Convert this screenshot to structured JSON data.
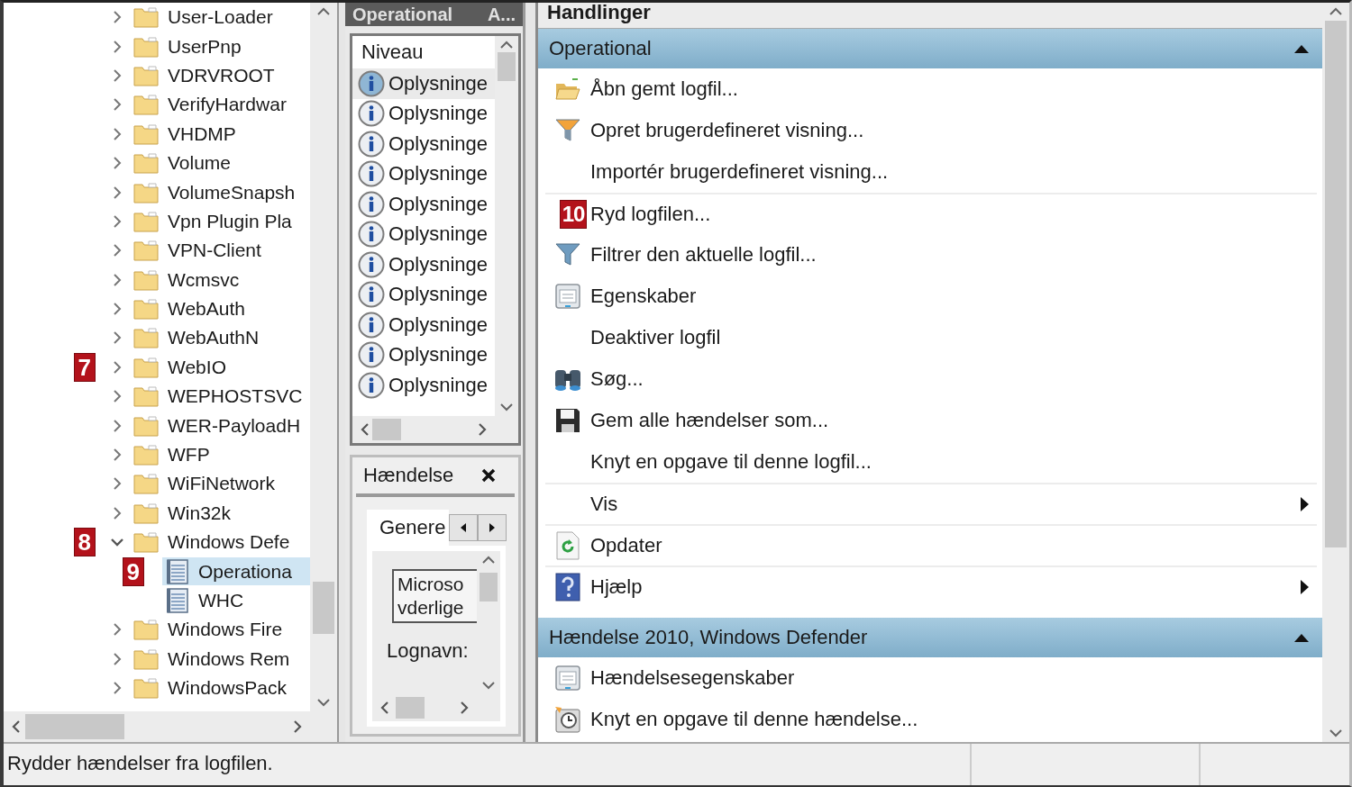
{
  "tree": {
    "items": [
      {
        "label": "User-Loader",
        "kind": "folder",
        "expanded": false,
        "selected": false
      },
      {
        "label": "UserPnp",
        "kind": "folder",
        "expanded": false,
        "selected": false
      },
      {
        "label": "VDRVROOT",
        "kind": "folder",
        "expanded": false,
        "selected": false
      },
      {
        "label": "VerifyHardwar",
        "kind": "folder",
        "expanded": false,
        "selected": false
      },
      {
        "label": "VHDMP",
        "kind": "folder",
        "expanded": false,
        "selected": false
      },
      {
        "label": "Volume",
        "kind": "folder",
        "expanded": false,
        "selected": false
      },
      {
        "label": "VolumeSnapsh",
        "kind": "folder",
        "expanded": false,
        "selected": false
      },
      {
        "label": "Vpn Plugin Pla",
        "kind": "folder",
        "expanded": false,
        "selected": false
      },
      {
        "label": "VPN-Client",
        "kind": "folder",
        "expanded": false,
        "selected": false
      },
      {
        "label": "Wcmsvc",
        "kind": "folder",
        "expanded": false,
        "selected": false
      },
      {
        "label": "WebAuth",
        "kind": "folder",
        "expanded": false,
        "selected": false
      },
      {
        "label": "WebAuthN",
        "kind": "folder",
        "expanded": false,
        "selected": false
      },
      {
        "label": "WebIO",
        "kind": "folder",
        "expanded": false,
        "selected": false,
        "badge": "7"
      },
      {
        "label": "WEPHOSTSVC",
        "kind": "folder",
        "expanded": false,
        "selected": false
      },
      {
        "label": "WER-PayloadH",
        "kind": "folder",
        "expanded": false,
        "selected": false
      },
      {
        "label": "WFP",
        "kind": "folder",
        "expanded": false,
        "selected": false
      },
      {
        "label": "WiFiNetwork",
        "kind": "folder",
        "expanded": false,
        "selected": false
      },
      {
        "label": "Win32k",
        "kind": "folder",
        "expanded": false,
        "selected": false
      },
      {
        "label": "Windows Defe",
        "kind": "folder",
        "expanded": true,
        "selected": false,
        "badge": "8",
        "children": [
          {
            "label": "Operationa",
            "kind": "log",
            "selected": true,
            "badge": "9"
          },
          {
            "label": "WHC",
            "kind": "log",
            "selected": false
          }
        ]
      },
      {
        "label": "Windows Fire",
        "kind": "folder",
        "expanded": false,
        "selected": false
      },
      {
        "label": "Windows Rem",
        "kind": "folder",
        "expanded": false,
        "selected": false
      },
      {
        "label": "WindowsPack",
        "kind": "folder",
        "expanded": false,
        "selected": false
      }
    ]
  },
  "events": {
    "title": "Operational",
    "title_2": "A...",
    "column": "Niveau",
    "rows": [
      {
        "level": "Oplysninge",
        "selected": true
      },
      {
        "level": "Oplysninge",
        "selected": false
      },
      {
        "level": "Oplysninge",
        "selected": false
      },
      {
        "level": "Oplysninge",
        "selected": false
      },
      {
        "level": "Oplysninge",
        "selected": false
      },
      {
        "level": "Oplysninge",
        "selected": false
      },
      {
        "level": "Oplysninge",
        "selected": false
      },
      {
        "level": "Oplysninge",
        "selected": false
      },
      {
        "level": "Oplysninge",
        "selected": false
      },
      {
        "level": "Oplysninge",
        "selected": false
      },
      {
        "level": "Oplysninge",
        "selected": false
      }
    ]
  },
  "event_panel": {
    "title": "Hændelse",
    "tabs": [
      {
        "label": "Genere",
        "selected": true
      }
    ],
    "field_lines": [
      "Microso",
      "vderlige"
    ],
    "label": "Lognavn:"
  },
  "actions": {
    "title": "Handlinger",
    "sections": [
      {
        "title": "Operational",
        "expanded": true,
        "items": [
          {
            "label": "Åbn gemt logfil...",
            "kind": "open",
            "separator_above": false,
            "submenu": false
          },
          {
            "label": "Opret brugerdefineret visning...",
            "kind": "custom-view",
            "separator_above": false,
            "submenu": false
          },
          {
            "label": "Importér brugerdefineret visning...",
            "kind": "plain",
            "separator_above": false,
            "submenu": false
          },
          {
            "label": "Ryd logfilen...",
            "kind": "plain",
            "separator_above": true,
            "submenu": false,
            "badge": "10"
          },
          {
            "label": "Filtrer den aktuelle logfil...",
            "kind": "filter",
            "separator_above": false,
            "submenu": false
          },
          {
            "label": "Egenskaber",
            "kind": "properties",
            "separator_above": false,
            "submenu": false
          },
          {
            "label": "Deaktiver logfil",
            "kind": "plain",
            "separator_above": false,
            "submenu": false
          },
          {
            "label": "Søg...",
            "kind": "find",
            "separator_above": false,
            "submenu": false
          },
          {
            "label": "Gem alle hændelser som...",
            "kind": "save",
            "separator_above": false,
            "submenu": false
          },
          {
            "label": "Knyt en opgave til denne logfil...",
            "kind": "plain",
            "separator_above": false,
            "submenu": false
          },
          {
            "label": "Vis",
            "kind": "plain",
            "separator_above": true,
            "submenu": true
          },
          {
            "label": "Opdater",
            "kind": "refresh",
            "separator_above": true,
            "submenu": false
          },
          {
            "label": "Hjælp",
            "kind": "help",
            "separator_above": true,
            "submenu": true
          }
        ]
      },
      {
        "title": "Hændelse 2010, Windows Defender",
        "expanded": true,
        "items": [
          {
            "label": "Hændelsesegenskaber",
            "kind": "properties",
            "separator_above": false,
            "submenu": false
          },
          {
            "label": "Knyt en opgave til denne hændelse...",
            "kind": "task",
            "separator_above": false,
            "submenu": false
          }
        ]
      }
    ]
  },
  "status_bar": {
    "text": "Rydder hændelser fra logfilen."
  }
}
